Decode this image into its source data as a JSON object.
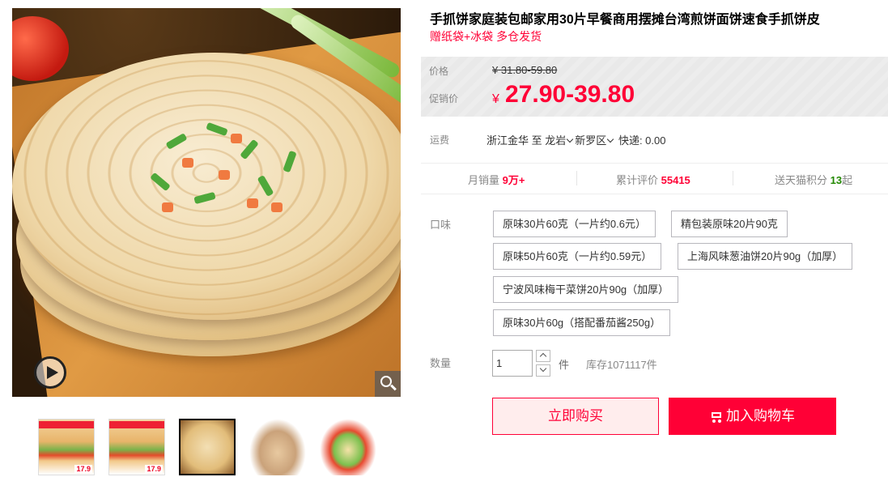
{
  "product": {
    "title": "手抓饼家庭装包邮家用30片早餐商用摆摊台湾煎饼面饼速食手抓饼皮",
    "subtitle": "赠纸袋+冰袋 多仓发货"
  },
  "gallery": {
    "main_image": "scallion-pancake-photo",
    "thumbnails": [
      {
        "name": "burger-pancake-thumb",
        "price": "17.9"
      },
      {
        "name": "burger-pancake-thumb-2",
        "price": "17.9"
      },
      {
        "name": "pancake-thumb"
      },
      {
        "name": "noodle-pancake-thumb"
      },
      {
        "name": "wrap-pancake-thumb"
      }
    ],
    "active_thumbnail": 2
  },
  "price": {
    "label": "价格",
    "yen": "¥",
    "original": "31.80-59.80",
    "promo_label": "促销价",
    "promo": "27.90-39.80"
  },
  "shipping": {
    "label": "运费",
    "origin": "浙江金华",
    "to": "至",
    "city": "龙岩",
    "district": "新罗区",
    "fee": "快递: 0.00"
  },
  "stats": {
    "monthly_sales_label": "月销量",
    "monthly_sales": "9万+",
    "reviews_label": "累计评价",
    "reviews": "55415",
    "points_label": "送天猫积分",
    "points": "13",
    "points_suffix": "起"
  },
  "options": {
    "flavor_label": "口味",
    "skus": [
      "原味30片60克（一片约0.6元）",
      "精包装原味20片90克",
      "原味50片60克（一片约0.59元）",
      "上海风味葱油饼20片90g（加厚）",
      "宁波风味梅干菜饼20片90g（加厚）",
      "原味30片60g（搭配番茄酱250g）"
    ]
  },
  "quantity": {
    "label": "数量",
    "value": "1",
    "unit": "件",
    "stock": "库存1071117件"
  },
  "actions": {
    "buy_now": "立即购买",
    "add_to_cart": "加入购物车"
  },
  "colors": {
    "accent": "#ff0036",
    "points_green": "#228800"
  }
}
